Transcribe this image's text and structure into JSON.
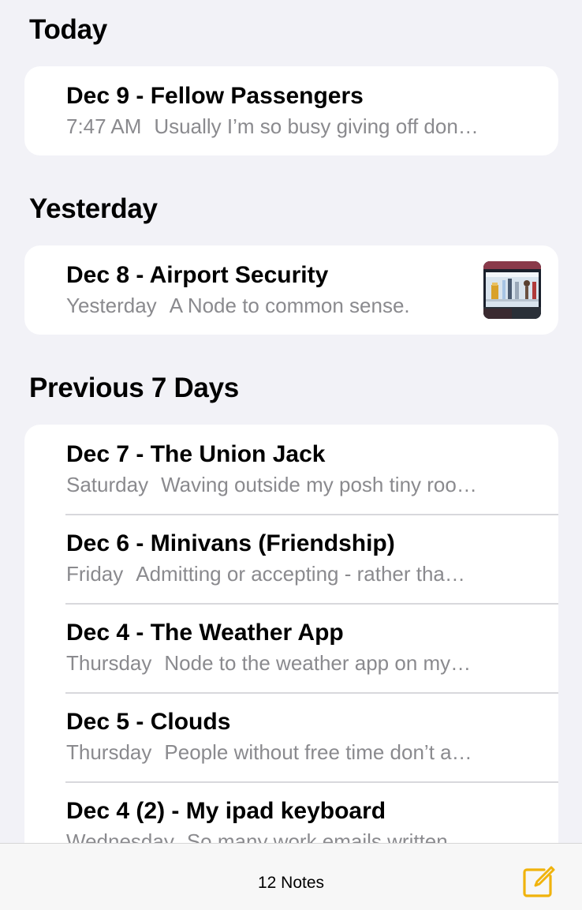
{
  "sections": [
    {
      "title": "Today",
      "notes": [
        {
          "title": "Dec 9 - Fellow Passengers",
          "date": "7:47 AM",
          "preview": "Usually I’m so busy giving off don…"
        }
      ]
    },
    {
      "title": "Yesterday",
      "notes": [
        {
          "title": "Dec 8 - Airport Security",
          "date": "Yesterday",
          "preview": "A Node to common sense.",
          "thumbnail": "airport-display-case-photo"
        }
      ]
    },
    {
      "title": "Previous 7 Days",
      "notes": [
        {
          "title": "Dec 7 - The Union Jack",
          "date": "Saturday",
          "preview": "Waving outside my posh tiny roo…"
        },
        {
          "title": "Dec 6 - Minivans (Friendship)",
          "date": "Friday",
          "preview": "Admitting or accepting - rather tha…"
        },
        {
          "title": "Dec 4 - The Weather App",
          "date": "Thursday",
          "preview": "Node to the weather app on my…"
        },
        {
          "title": "Dec 5 - Clouds",
          "date": "Thursday",
          "preview": "People without free time don’t a…"
        },
        {
          "title": "Dec 4 (2) - My ipad keyboard",
          "date": "Wednesday",
          "preview": "So many work emails written…"
        }
      ]
    }
  ],
  "toolbar": {
    "count_label": "12 Notes",
    "compose_icon": "compose-icon",
    "accent_color": "#f0b30c"
  }
}
